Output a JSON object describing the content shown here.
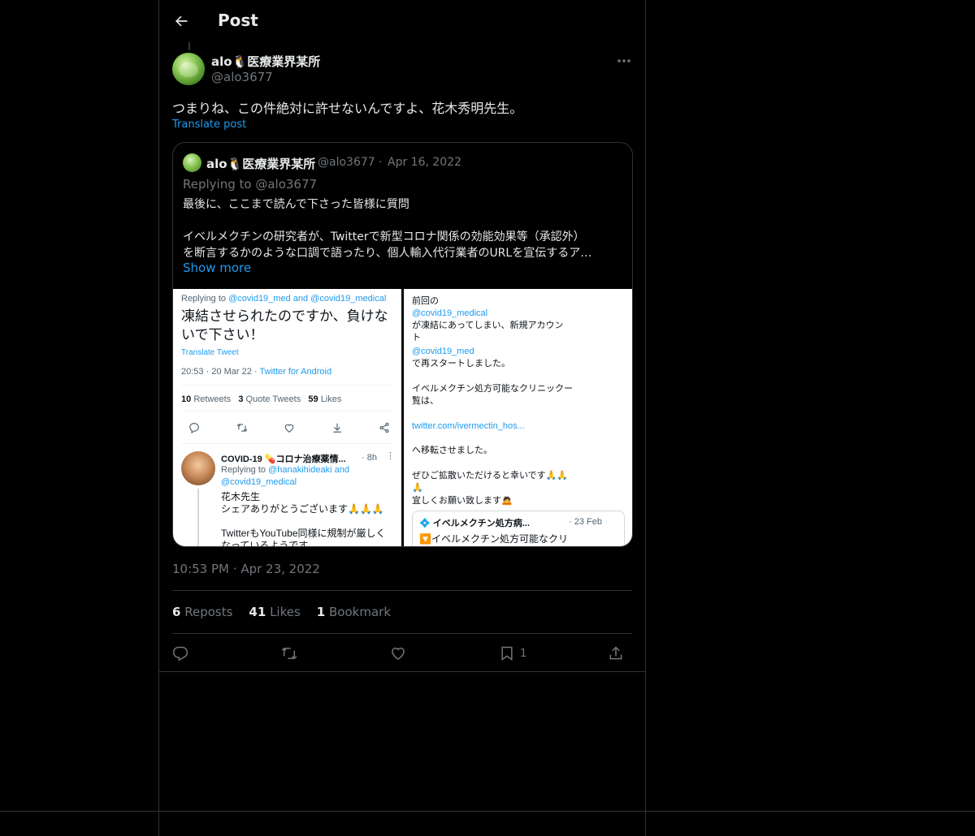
{
  "header": {
    "title": "Post"
  },
  "post": {
    "author_name": "alo🐧医療業界某所",
    "author_handle": "@alo3677",
    "text": "つまりね、この件絶対に許せないんですよ、花木秀明先生。",
    "translate_label": "Translate post",
    "timestamp_time": "10:53 PM",
    "timestamp_date": "Apr 23, 2022",
    "stats": {
      "reposts_count": "6",
      "reposts_label": "Reposts",
      "likes_count": "41",
      "likes_label": "Likes",
      "bookmarks_count": "1",
      "bookmarks_label": "Bookmark"
    },
    "bookmark_action_count": "1"
  },
  "quote": {
    "author_name": "alo🐧医療業界某所",
    "author_handle": "@alo3677",
    "separator": "·",
    "date": "Apr 16, 2022",
    "replying_prefix": "Replying to ",
    "replying_to": "@alo3677",
    "line1": "最後に、ここまで読んで下さった皆様に質問",
    "line2": "イベルメクチンの研究者が、Twitterで新型コロナ関係の効能効果等（承認外）",
    "line3": "を断言するかのような口調で語ったり、個人輸入代行業者のURLを宣伝するア…",
    "show_more": "Show more",
    "media_left": {
      "replying_prefix": "Replying to ",
      "replying_to": "@covid19_med and @covid19_medical",
      "big_text": "凍結させられたのですか、負けないで下さい！",
      "translate": "Translate Tweet",
      "time": "20:53 · 20 Mar 22 · ",
      "client": "Twitter for Android",
      "retweets_count": "10",
      "retweets_label": "Retweets",
      "quotes_count": "3",
      "quotes_label": "Quote Tweets",
      "likes_count": "59",
      "likes_label": "Likes",
      "reply_name": "COVID-19 💊コロナ治療薬情...",
      "reply_time": "· 8h",
      "reply_dots": "⋮",
      "reply_to_prefix": "Replying to ",
      "reply_to_a": "@hanakihideaki and",
      "reply_to_b": "@covid19_medical",
      "reply_line1": "花木先生",
      "reply_line2": "シェアありがとうございます🙏🙏🙏",
      "reply_line3": "",
      "reply_line4": "TwitterもYouTube同様に規制が厳しく",
      "reply_line5": "なっているようです。"
    },
    "media_right": {
      "l1": "前回の",
      "l2": "@covid19_medical",
      "l3": " が凍結にあってしまい、新規アカウン",
      "l4": "ト",
      "l5": "@covid19_med",
      "l6": "で再スタートしました。",
      "l7": "イベルメクチン処方可能なクリニックー",
      "l8": "覧は、",
      "l9": "twitter.com/ivermectin_hos...",
      "l10": "へ移転させました。",
      "l11": "ぜひご拡散いただけると幸いです🙏🙏",
      "l12": "🙏",
      "l13": "宜しくお願い致します🙇",
      "card_title": "💠 イベルメクチン処方病...",
      "card_date": "· 23 Feb",
      "card_body": "🔽イベルメクチン処方可能なクリ"
    }
  },
  "colors": {
    "accent": "#1d9bf0",
    "muted": "#71767b",
    "text": "#e7e9ea",
    "border": "#2f3336",
    "background": "#000000"
  },
  "icons": [
    "back-arrow-icon",
    "more-icon",
    "reply-icon",
    "repost-icon",
    "like-icon",
    "bookmark-icon",
    "share-icon"
  ]
}
